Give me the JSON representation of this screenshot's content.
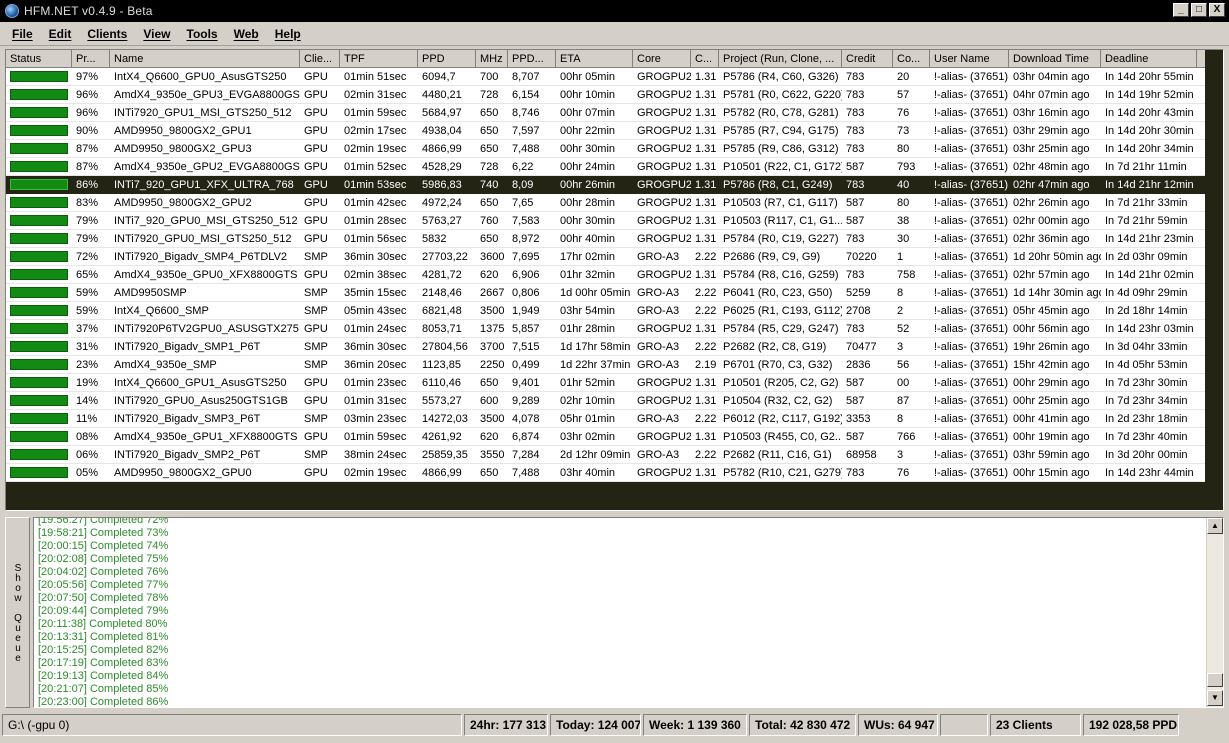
{
  "window": {
    "title": "HFM.NET v0.4.9 - Beta",
    "buttons": [
      "_",
      "□",
      "X"
    ]
  },
  "menu": [
    "File",
    "Edit",
    "Clients",
    "View",
    "Tools",
    "Web",
    "Help"
  ],
  "grid": {
    "headers": [
      "Status",
      "Pr...",
      "Name",
      "Clie...",
      "TPF",
      "PPD",
      "MHz",
      "PPD...",
      "ETA",
      "Core",
      "C...",
      "Project (Run, Clone, ...",
      "Credit",
      "Co...",
      "User Name",
      "Download Time",
      "Deadline"
    ],
    "status_color": "#138a13",
    "selected_row": 6,
    "rows": [
      [
        "97%",
        "IntX4_Q6600_GPU0_AsusGTS250",
        "GPU",
        "01min 51sec",
        "6094,7",
        "700",
        "8,707",
        "00hr 05min",
        "GROGPU2",
        "1.31",
        "P5786 (R4, C60, G326)",
        "783",
        "20",
        "!-alias- (37651)",
        "03hr 04min ago",
        "In 14d 20hr 55min"
      ],
      [
        "96%",
        "AmdX4_9350e_GPU3_EVGA8800GS",
        "GPU",
        "02min 31sec",
        "4480,21",
        "728",
        "6,154",
        "00hr 10min",
        "GROGPU2",
        "1.31",
        "P5781 (R0, C622, G220)",
        "783",
        "57",
        "!-alias- (37651)",
        "04hr 07min ago",
        "In 14d 19hr 52min"
      ],
      [
        "96%",
        "INTi7920_GPU1_MSI_GTS250_512",
        "GPU",
        "01min 59sec",
        "5684,97",
        "650",
        "8,746",
        "00hr 07min",
        "GROGPU2",
        "1.31",
        "P5782 (R0, C78, G281)",
        "783",
        "76",
        "!-alias- (37651)",
        "03hr 16min ago",
        "In 14d 20hr 43min"
      ],
      [
        "90%",
        "AMD9950_9800GX2_GPU1",
        "GPU",
        "02min 17sec",
        "4938,04",
        "650",
        "7,597",
        "00hr 22min",
        "GROGPU2",
        "1.31",
        "P5785 (R7, C94, G175)",
        "783",
        "73",
        "!-alias- (37651)",
        "03hr 29min ago",
        "In 14d 20hr 30min"
      ],
      [
        "87%",
        "AMD9950_9800GX2_GPU3",
        "GPU",
        "02min 19sec",
        "4866,99",
        "650",
        "7,488",
        "00hr 30min",
        "GROGPU2",
        "1.31",
        "P5785 (R9, C86, G312)",
        "783",
        "80",
        "!-alias- (37651)",
        "03hr 25min ago",
        "In 14d 20hr 34min"
      ],
      [
        "87%",
        "AmdX4_9350e_GPU2_EVGA8800GS",
        "GPU",
        "01min 52sec",
        "4528,29",
        "728",
        "6,22",
        "00hr 24min",
        "GROGPU2",
        "1.31",
        "P10501 (R22, C1, G172)",
        "587",
        "793",
        "!-alias- (37651)",
        "02hr 48min ago",
        "In 7d 21hr 11min"
      ],
      [
        "86%",
        "INTi7_920_GPU1_XFX_ULTRA_768",
        "GPU",
        "01min 53sec",
        "5986,83",
        "740",
        "8,09",
        "00hr 26min",
        "GROGPU2",
        "1.31",
        "P5786 (R8, C1, G249)",
        "783",
        "40",
        "!-alias- (37651)",
        "02hr 47min ago",
        "In 14d 21hr 12min"
      ],
      [
        "83%",
        "AMD9950_9800GX2_GPU2",
        "GPU",
        "01min 42sec",
        "4972,24",
        "650",
        "7,65",
        "00hr 28min",
        "GROGPU2",
        "1.31",
        "P10503 (R7, C1, G117)",
        "587",
        "80",
        "!-alias- (37651)",
        "02hr 26min ago",
        "In 7d 21hr 33min"
      ],
      [
        "79%",
        "INTi7_920_GPU0_MSI_GTS250_512",
        "GPU",
        "01min 28sec",
        "5763,27",
        "760",
        "7,583",
        "00hr 30min",
        "GROGPU2",
        "1.31",
        "P10503 (R117, C1, G1...",
        "587",
        "38",
        "!-alias- (37651)",
        "02hr 00min ago",
        "In 7d 21hr 59min"
      ],
      [
        "79%",
        "INTi7920_GPU0_MSI_GTS250_512",
        "GPU",
        "01min 56sec",
        "5832",
        "650",
        "8,972",
        "00hr 40min",
        "GROGPU2",
        "1.31",
        "P5784 (R0, C19, G227)",
        "783",
        "30",
        "!-alias- (37651)",
        "02hr 36min ago",
        "In 14d 21hr 23min"
      ],
      [
        "72%",
        "INTi7920_Bigadv_SMP4_P6TDLV2",
        "SMP",
        "36min 30sec",
        "27703,22",
        "3600",
        "7,695",
        "17hr 02min",
        "GRO-A3",
        "2.22",
        "P2686 (R9, C9, G9)",
        "70220",
        "1",
        "!-alias- (37651)",
        "1d 20hr 50min ago",
        "In 2d 03hr 09min"
      ],
      [
        "65%",
        "AmdX4_9350e_GPU0_XFX8800GTS",
        "GPU",
        "02min 38sec",
        "4281,72",
        "620",
        "6,906",
        "01hr 32min",
        "GROGPU2",
        "1.31",
        "P5784 (R8, C16, G259)",
        "783",
        "758",
        "!-alias- (37651)",
        "02hr 57min ago",
        "In 14d 21hr 02min"
      ],
      [
        "59%",
        "AMD9950SMP",
        "SMP",
        "35min 15sec",
        "2148,46",
        "2667",
        "0,806",
        "1d 00hr 05min",
        "GRO-A3",
        "2.22",
        "P6041 (R0, C23, G50)",
        "5259",
        "8",
        "!-alias- (37651)",
        "1d 14hr 30min ago",
        "In 4d 09hr 29min"
      ],
      [
        "59%",
        "IntX4_Q6600_SMP",
        "SMP",
        "05min 43sec",
        "6821,48",
        "3500",
        "1,949",
        "03hr 54min",
        "GRO-A3",
        "2.22",
        "P6025 (R1, C193, G112)",
        "2708",
        "2",
        "!-alias- (37651)",
        "05hr 45min ago",
        "In 2d 18hr 14min"
      ],
      [
        "37%",
        "INTi7920P6TV2GPU0_ASUSGTX275",
        "GPU",
        "01min 24sec",
        "8053,71",
        "1375",
        "5,857",
        "01hr 28min",
        "GROGPU2",
        "1.31",
        "P5784 (R5, C29, G247)",
        "783",
        "52",
        "!-alias- (37651)",
        "00hr 56min ago",
        "In 14d 23hr 03min"
      ],
      [
        "31%",
        "INTi7920_Bigadv_SMP1_P6T",
        "SMP",
        "36min 30sec",
        "27804,56",
        "3700",
        "7,515",
        "1d 17hr 58min",
        "GRO-A3",
        "2.22",
        "P2682 (R2, C8, G19)",
        "70477",
        "3",
        "!-alias- (37651)",
        "19hr 26min ago",
        "In 3d 04hr 33min"
      ],
      [
        "23%",
        "AmdX4_9350e_SMP",
        "SMP",
        "36min 20sec",
        "1123,85",
        "2250",
        "0,499",
        "1d 22hr 37min",
        "GRO-A3",
        "2.19",
        "P6701 (R70, C3, G32)",
        "2836",
        "56",
        "!-alias- (37651)",
        "15hr 42min ago",
        "In 4d 05hr 53min"
      ],
      [
        "19%",
        "IntX4_Q6600_GPU1_AsusGTS250",
        "GPU",
        "01min 23sec",
        "6110,46",
        "650",
        "9,401",
        "01hr 52min",
        "GROGPU2",
        "1.31",
        "P10501 (R205, C2, G2)",
        "587",
        "00",
        "!-alias- (37651)",
        "00hr 29min ago",
        "In 7d 23hr 30min"
      ],
      [
        "14%",
        "INTi7920_GPU0_Asus250GTS1GB",
        "GPU",
        "01min 31sec",
        "5573,27",
        "600",
        "9,289",
        "02hr 10min",
        "GROGPU2",
        "1.31",
        "P10504 (R32, C2, G2)",
        "587",
        "87",
        "!-alias- (37651)",
        "00hr 25min ago",
        "In 7d 23hr 34min"
      ],
      [
        "11%",
        "INTi7920_Bigadv_SMP3_P6T",
        "SMP",
        "03min 23sec",
        "14272,03",
        "3500",
        "4,078",
        "05hr 01min",
        "GRO-A3",
        "2.22",
        "P6012 (R2, C117, G192)",
        "3353",
        "8",
        "!-alias- (37651)",
        "00hr 41min ago",
        "In 2d 23hr 18min"
      ],
      [
        "08%",
        "AmdX4_9350e_GPU1_XFX8800GTS",
        "GPU",
        "01min 59sec",
        "4261,92",
        "620",
        "6,874",
        "03hr 02min",
        "GROGPU2",
        "1.31",
        "P10503 (R455, C0, G2...",
        "587",
        "766",
        "!-alias- (37651)",
        "00hr 19min ago",
        "In 7d 23hr 40min"
      ],
      [
        "06%",
        "INTi7920_Bigadv_SMP2_P6T",
        "SMP",
        "38min 24sec",
        "25859,35",
        "3550",
        "7,284",
        "2d 12hr 09min",
        "GRO-A3",
        "2.22",
        "P2682 (R11, C16, G1)",
        "68958",
        "3",
        "!-alias- (37651)",
        "03hr 59min ago",
        "In 3d 20hr 00min"
      ],
      [
        "05%",
        "AMD9950_9800GX2_GPU0",
        "GPU",
        "02min 19sec",
        "4866,99",
        "650",
        "7,488",
        "03hr 40min",
        "GROGPU2",
        "1.31",
        "P5782 (R10, C21, G279)",
        "783",
        "76",
        "!-alias- (37651)",
        "00hr 15min ago",
        "In 14d 23hr 44min"
      ]
    ]
  },
  "queue_button": "Show Queue",
  "log": [
    "[19:56:27] Completed 72%",
    "[19:58:21] Completed 73%",
    "[20:00:15] Completed 74%",
    "[20:02:08] Completed 75%",
    "[20:04:02] Completed 76%",
    "[20:05:56] Completed 77%",
    "[20:07:50] Completed 78%",
    "[20:09:44] Completed 79%",
    "[20:11:38] Completed 80%",
    "[20:13:31] Completed 81%",
    "[20:15:25] Completed 82%",
    "[20:17:19] Completed 83%",
    "[20:19:13] Completed 84%",
    "[20:21:07] Completed 85%",
    "[20:23:00] Completed 86%"
  ],
  "statusbar": {
    "path": "G:\\ (-gpu 0)",
    "day": "24hr: 177 313",
    "today": "Today: 124 007",
    "week": "Week: 1 139 360",
    "total": "Total: 42 830 472",
    "wus": "WUs: 64 947",
    "blank": "",
    "clients": "23 Clients",
    "ppd": "192 028,58 PPD"
  }
}
